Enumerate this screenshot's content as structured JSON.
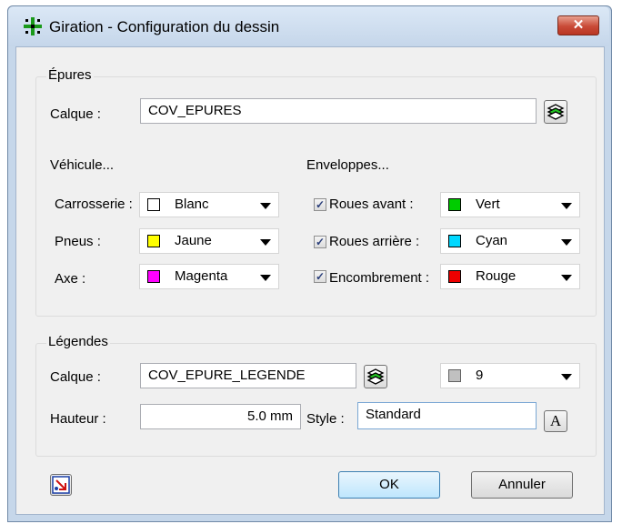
{
  "window": {
    "title": "Giration - Configuration du dessin",
    "close_glyph": "✕"
  },
  "epures": {
    "group_title": "Épures",
    "calque_label": "Calque :",
    "calque_value": "COV_EPURES",
    "vehicule_header": "Véhicule...",
    "enveloppes_header": "Enveloppes...",
    "vehicule": [
      {
        "label": "Carrosserie :",
        "value": "Blanc",
        "color": "#ffffff"
      },
      {
        "label": "Pneus :",
        "value": "Jaune",
        "color": "#ffff00"
      },
      {
        "label": "Axe :",
        "value": "Magenta",
        "color": "#ff00ff"
      }
    ],
    "enveloppes": [
      {
        "label": "Roues avant :",
        "value": "Vert",
        "color": "#00cc00",
        "checked": true
      },
      {
        "label": "Roues arrière :",
        "value": "Cyan",
        "color": "#00d8ff",
        "checked": true
      },
      {
        "label": "Encombrement :",
        "value": "Rouge",
        "color": "#ee0000",
        "checked": true
      }
    ]
  },
  "legendes": {
    "group_title": "Légendes",
    "calque_label": "Calque :",
    "calque_value": "COV_EPURE_LEGENDE",
    "color_value": "9",
    "color": "#c0c0c0",
    "hauteur_label": "Hauteur :",
    "hauteur_value": "5.0 mm",
    "style_label": "Style :",
    "style_value": "Standard"
  },
  "buttons": {
    "ok": "OK",
    "cancel": "Annuler"
  },
  "icons": {
    "app": "grid-target-icon",
    "layer": "layers-icon",
    "text_style": "text-style-icon",
    "text_style_glyph": "A",
    "import": "import-settings-icon"
  }
}
